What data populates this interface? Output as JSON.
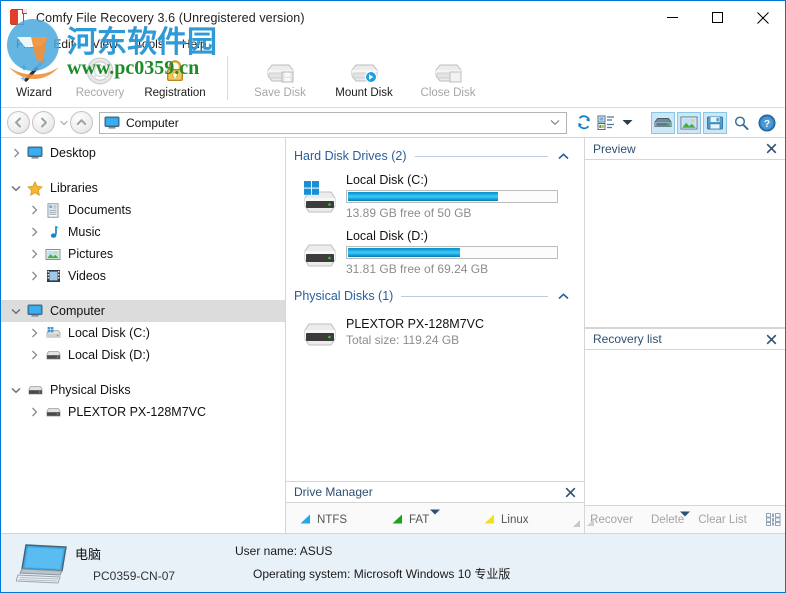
{
  "window": {
    "title": "Comfy File Recovery 3.6 (Unregistered version)",
    "app_icon": "app-document-icon",
    "accent_color": "#0078d7",
    "controls": {
      "minimize": "minimize-icon",
      "maximize": "maximize-icon",
      "close": "close-icon"
    }
  },
  "menubar": {
    "items": [
      {
        "label": "File"
      },
      {
        "label": "Edit"
      },
      {
        "label": "View"
      },
      {
        "label": "Tools"
      },
      {
        "label": "Help"
      }
    ]
  },
  "toolbar": {
    "left": [
      {
        "label": "Wizard",
        "icon": "wand-icon",
        "disabled": false
      },
      {
        "label": "Recovery",
        "icon": "lifebuoy-icon",
        "disabled": true
      },
      {
        "label": "Registration",
        "icon": "lock-icon",
        "disabled": false
      }
    ],
    "right": [
      {
        "label": "Save Disk",
        "icon": "save-disk-icon",
        "disabled": true
      },
      {
        "label": "Mount Disk",
        "icon": "mount-disk-icon",
        "disabled": false
      },
      {
        "label": "Close Disk",
        "icon": "close-disk-icon",
        "disabled": true
      }
    ]
  },
  "addressbar": {
    "back": "back-arrow-icon",
    "forward": "forward-arrow-icon",
    "history": "history-caret-icon",
    "up": "up-arrow-icon",
    "location_icon": "computer-icon",
    "location": "Computer",
    "dropdown": "chevron-down-icon",
    "refresh": "refresh-icon",
    "view_mode": "view-mode-icon",
    "view_mode_caret": "chevron-down-icon",
    "buttons": [
      {
        "icon": "drive-manager-icon",
        "active": true
      },
      {
        "icon": "preview-panel-icon",
        "active": true
      },
      {
        "icon": "recovery-list-icon",
        "active": true
      },
      {
        "icon": "search-icon",
        "active": false
      },
      {
        "icon": "help-icon",
        "active": false
      }
    ]
  },
  "tree": {
    "items": [
      {
        "label": "Desktop",
        "icon": "desktop-icon",
        "indent": 1,
        "expander": "collapsed",
        "selected": false
      },
      {
        "label": "Libraries",
        "icon": "star-icon",
        "indent": 1,
        "expander": "expanded",
        "selected": false
      },
      {
        "label": "Documents",
        "icon": "documents-icon",
        "indent": 2,
        "expander": "collapsed",
        "selected": false
      },
      {
        "label": "Music",
        "icon": "music-icon",
        "indent": 2,
        "expander": "collapsed",
        "selected": false
      },
      {
        "label": "Pictures",
        "icon": "pictures-icon",
        "indent": 2,
        "expander": "collapsed",
        "selected": false
      },
      {
        "label": "Videos",
        "icon": "videos-icon",
        "indent": 2,
        "expander": "collapsed",
        "selected": false
      },
      {
        "label": "Computer",
        "icon": "computer-icon",
        "indent": 1,
        "expander": "expanded",
        "selected": true
      },
      {
        "label": "Local Disk (C:)",
        "icon": "system-drive-icon",
        "indent": 2,
        "expander": "collapsed",
        "selected": false
      },
      {
        "label": "Local Disk (D:)",
        "icon": "drive-icon",
        "indent": 2,
        "expander": "collapsed",
        "selected": false
      },
      {
        "label": "Physical Disks",
        "icon": "drive-icon",
        "indent": 1,
        "expander": "expanded",
        "selected": false
      },
      {
        "label": "PLEXTOR PX-128M7VC",
        "icon": "drive-icon",
        "indent": 2,
        "expander": "collapsed",
        "selected": false
      }
    ]
  },
  "main": {
    "groups": [
      {
        "title": "Hard Disk Drives (2)",
        "collapse_icon": "chevron-up-icon",
        "drives": [
          {
            "name": "Local Disk (C:)",
            "icon": "windows-drive-icon",
            "usage_text": "13.89 GB free of 50 GB",
            "free_gb": 13.89,
            "total_gb": 50,
            "used_percent": 72
          },
          {
            "name": "Local Disk (D:)",
            "icon": "drive-icon",
            "usage_text": "31.81 GB free of 69.24 GB",
            "free_gb": 31.81,
            "total_gb": 69.24,
            "used_percent": 54
          }
        ]
      }
    ],
    "physical": {
      "title": "Physical Disks (1)",
      "collapse_icon": "chevron-up-icon",
      "disks": [
        {
          "name": "PLEXTOR PX-128M7VC",
          "icon": "drive-icon",
          "size_text": "Total size: 119.24 GB",
          "total_gb": 119.24
        }
      ]
    }
  },
  "drive_manager": {
    "title": "Drive Manager",
    "close_icon": "close-icon",
    "expand_caret": "caret-down-icon",
    "legend": [
      {
        "label": "NTFS",
        "color": "#22a7e8"
      },
      {
        "label": "FAT",
        "color": "#18a318"
      },
      {
        "label": "Linux",
        "color": "#f2e018"
      }
    ]
  },
  "preview": {
    "title": "Preview",
    "close_icon": "close-icon"
  },
  "recovery_list": {
    "title": "Recovery list",
    "close_icon": "close-icon",
    "expand_caret": "caret-down-icon",
    "actions": [
      {
        "label": "Recover",
        "disabled": true
      },
      {
        "label": "Delete",
        "disabled": true
      },
      {
        "label": "Clear List",
        "disabled": true
      }
    ],
    "grid_icon": "grid-view-icon"
  },
  "statusbar": {
    "icon": "monitor-icon",
    "computer_label": "电脑",
    "computer_name": "PC0359-CN-07",
    "user_line": "User name: ASUS",
    "os_line": "Operating system: Microsoft Windows 10 专业版"
  },
  "watermark": {
    "text_cn": "河东软件园",
    "url": "www.pc0359.cn",
    "logo": "watermark-logo-icon"
  }
}
